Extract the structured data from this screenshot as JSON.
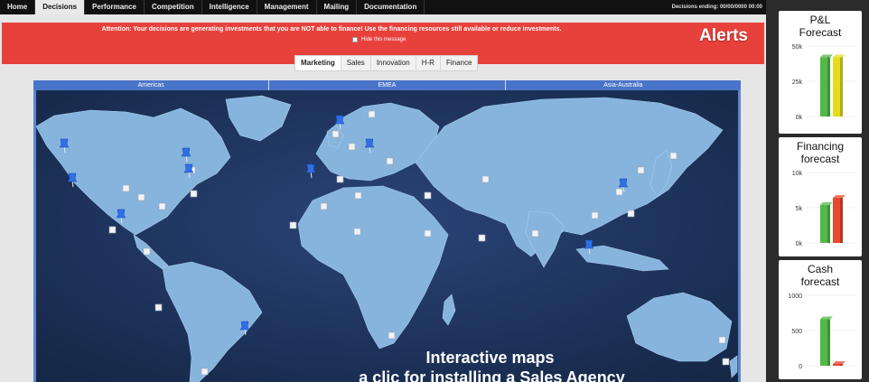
{
  "nav": {
    "tabs": [
      {
        "label": "Home"
      },
      {
        "label": "Decisions"
      },
      {
        "label": "Performance"
      },
      {
        "label": "Competition"
      },
      {
        "label": "Intelligence"
      },
      {
        "label": "Management"
      },
      {
        "label": "Mailing"
      },
      {
        "label": "Documentation"
      }
    ],
    "active_tab": "Decisions",
    "deadline": "Decisions ending: 00/00/0000 00:00"
  },
  "alert": {
    "message": "Attention: Your decisions are generating investments that you are NOT able to finance! Use the financing resources still available or reduce investments.",
    "hide_label": "Hide this message",
    "title": "Alerts",
    "color": "#e8413c"
  },
  "subtabs": {
    "items": [
      {
        "label": "Marketing"
      },
      {
        "label": "Sales"
      },
      {
        "label": "Innovation"
      },
      {
        "label": "H-R"
      },
      {
        "label": "Finance"
      }
    ],
    "active": "Marketing"
  },
  "regions": [
    {
      "label": "Americas"
    },
    {
      "label": "EMEA"
    },
    {
      "label": "Asia-Australia"
    }
  ],
  "map": {
    "caption_line1": "Interactive maps",
    "caption_line2": "a clic for installing a Sales Agency",
    "ocean_color": "#1d3158",
    "land_color": "#86b4dd",
    "pin_color": "#2f6fe8"
  },
  "forecasts": [
    {
      "title": [
        "P&L",
        "Forecast"
      ],
      "ticks": [
        "50k",
        "25k",
        "0k"
      ],
      "bar_fractions": [
        0.84,
        0.84
      ],
      "bar_colors": [
        "#52b947",
        "#e5dc1f"
      ]
    },
    {
      "title": [
        "Financing",
        "forecast"
      ],
      "ticks": [
        "10k",
        "5k",
        "0k"
      ],
      "bar_fractions": [
        0.54,
        0.64
      ],
      "bar_colors": [
        "#52b947",
        "#e8482f"
      ]
    },
    {
      "title": [
        "Cash",
        "forecast"
      ],
      "ticks": [
        "1000",
        "500",
        "0"
      ],
      "bar_fractions": [
        0.66,
        0.02
      ],
      "bar_colors": [
        "#52b947",
        "#e8482f"
      ]
    }
  ]
}
